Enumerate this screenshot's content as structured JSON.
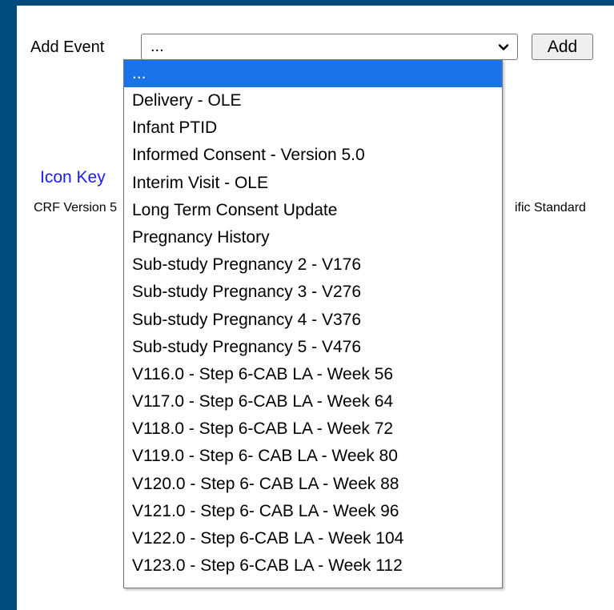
{
  "form": {
    "add_event_label": "Add Event",
    "selected_value": "...",
    "add_button_label": "Add"
  },
  "icon_key_label": "Icon Key",
  "crf_text_left": "CRF Version 5",
  "crf_text_right": "ific Standard",
  "dropdown": {
    "highlighted_index": 0,
    "options": [
      "...",
      "Delivery - OLE",
      "Infant PTID",
      "Informed Consent - Version 5.0",
      "Interim Visit - OLE",
      "Long Term Consent Update",
      "Pregnancy History",
      "Sub-study Pregnancy 2 - V176",
      "Sub-study Pregnancy 3 - V276",
      "Sub-study Pregnancy 4 - V376",
      "Sub-study Pregnancy 5 - V476",
      "V116.0 - Step 6-CAB LA - Week 56",
      "V117.0 - Step 6-CAB LA - Week 64",
      "V118.0 - Step 6-CAB LA - Week 72",
      "V119.0 - Step 6- CAB LA - Week 80",
      "V120.0 - Step 6- CAB LA - Week 88",
      "V121.0 - Step 6- CAB LA - Week 96",
      "V122.0 - Step 6-CAB LA - Week 104",
      "V123.0 - Step 6-CAB LA - Week 112"
    ]
  },
  "colors": {
    "page_background": "#004a7c",
    "highlight": "#1a73e8",
    "link": "#1a1aff"
  },
  "icons": {
    "select_arrow": "chevron-down-icon"
  }
}
